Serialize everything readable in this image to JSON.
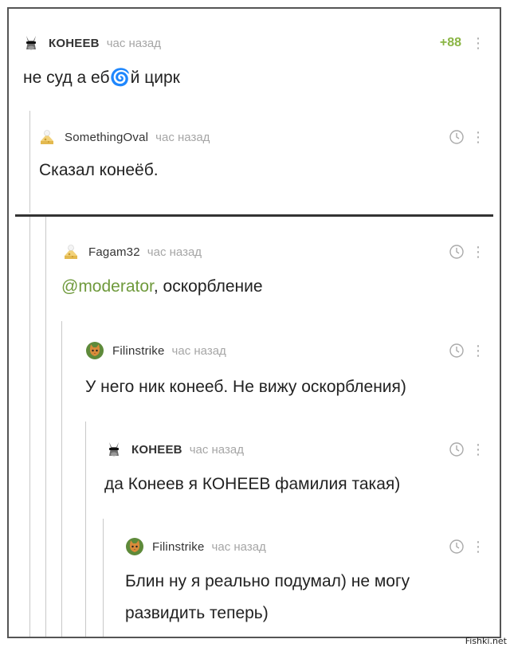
{
  "colors": {
    "accent": "#8ab544",
    "mention": "#6f9a3c",
    "muted": "#a6a6a6"
  },
  "comments": [
    {
      "author": "КОНЕЕВ",
      "time": "час назад",
      "rating": "+88",
      "text": "не суд а еб🌀й цирк",
      "avatar": "donkey-sunglasses-avatar"
    },
    {
      "author": "SomethingOval",
      "time": "час назад",
      "text": "Сказал конеёб.",
      "avatar": "default-cheese-avatar"
    },
    {
      "author": "Fagam32",
      "time": "час назад",
      "mention": "@moderator",
      "text": ", оскорбление",
      "avatar": "default-cheese-avatar"
    },
    {
      "author": "Filinstrike",
      "time": "час назад",
      "text": "У него ник конееб. Не вижу оскорбления)",
      "avatar": "cat-avatar"
    },
    {
      "author": "КОНЕЕВ",
      "time": "час назад",
      "text": "да Конеев я КОНЕЕВ фамилия такая)",
      "avatar": "donkey-sunglasses-avatar"
    },
    {
      "author": "Filinstrike",
      "time": "час назад",
      "text_line1": "Блин ну я реально подумал) не могу",
      "text_line2": "развидить теперь)",
      "avatar": "cat-avatar"
    }
  ],
  "menu_glyph": "⋮",
  "watermark": "Fishki.net"
}
